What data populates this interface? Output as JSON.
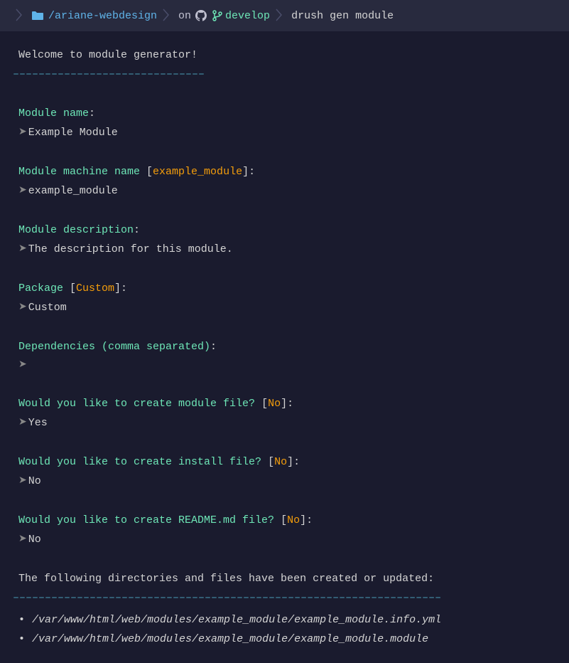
{
  "breadcrumb": {
    "path": "/ariane-webdesign",
    "on": "on",
    "branch": "develop",
    "command": "drush gen module"
  },
  "header": {
    "title": " Welcome to module generator!",
    "underline": "––––––––––––––––––––––––––––––"
  },
  "prompts": [
    {
      "label": "Module name",
      "default": "",
      "answer": "Example Module"
    },
    {
      "label": "Module machine name",
      "default": "example_module",
      "answer": "example_module"
    },
    {
      "label": "Module description",
      "default": "",
      "answer": "The description for this module."
    },
    {
      "label": "Package",
      "default": "Custom",
      "answer": "Custom"
    },
    {
      "label": "Dependencies (comma separated)",
      "default": "",
      "answer": ""
    },
    {
      "label": "Would you like to create module file?",
      "default": "No",
      "answer": "Yes"
    },
    {
      "label": "Would you like to create install file?",
      "default": "No",
      "answer": "No"
    },
    {
      "label": "Would you like to create README.md file?",
      "default": "No",
      "answer": "No"
    }
  ],
  "footer": {
    "title": " The following directories and files have been created or updated:",
    "underline": "–––––––––––––––––––––––––––––––––––––––––––––––––––––––––––––––––––",
    "files": [
      "/var/www/html/web/modules/example_module/example_module.info.yml",
      "/var/www/html/web/modules/example_module/example_module.module"
    ]
  }
}
